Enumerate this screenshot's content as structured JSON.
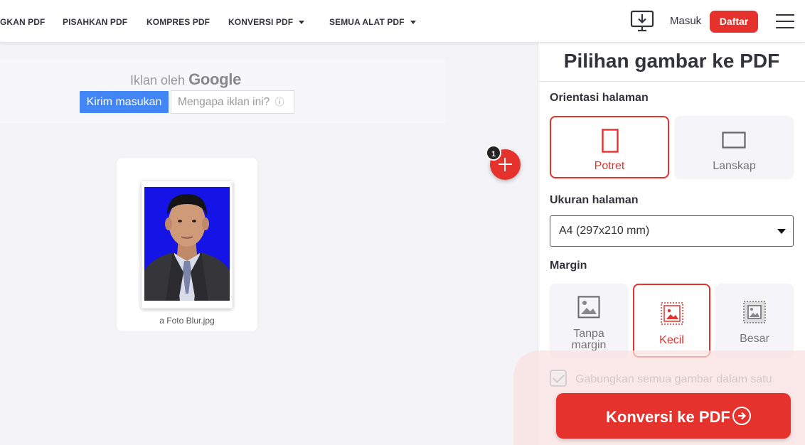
{
  "nav": {
    "items": [
      {
        "label": "GKAN PDF"
      },
      {
        "label": "PISAHKAN PDF"
      },
      {
        "label": "KOMPRES PDF"
      },
      {
        "label": "KONVERSI PDF"
      },
      {
        "label": "SEMUA ALAT PDF"
      }
    ],
    "login": "Masuk",
    "signup": "Daftar"
  },
  "ad": {
    "by_prefix": "Iklan oleh",
    "by_brand": "Google",
    "send_feedback": "Kirim masukan",
    "why_ad": "Mengapa iklan ini?",
    "info_glyph": "ⓘ"
  },
  "file": {
    "name": "a Foto Blur.jpg",
    "count_badge": "1"
  },
  "panel": {
    "title": "Pilihan gambar ke PDF",
    "orientation": {
      "label": "Orientasi halaman",
      "options": [
        {
          "label": "Potret",
          "selected": true
        },
        {
          "label": "Lanskap",
          "selected": false
        }
      ]
    },
    "page_size": {
      "label": "Ukuran halaman",
      "value": "A4 (297x210 mm)"
    },
    "margin": {
      "label": "Margin",
      "options": [
        {
          "label_line1": "Tanpa",
          "label_line2": "margin",
          "selected": false
        },
        {
          "label": "Kecil",
          "selected": true
        },
        {
          "label": "Besar",
          "selected": false
        }
      ]
    },
    "merge_label": "Gabungkan semua gambar dalam satu",
    "convert_button": "Konversi ke PDF"
  },
  "colors": {
    "accent": "#e5322d",
    "google_blue": "#4285f4",
    "photo_bg": "#1414e6"
  }
}
